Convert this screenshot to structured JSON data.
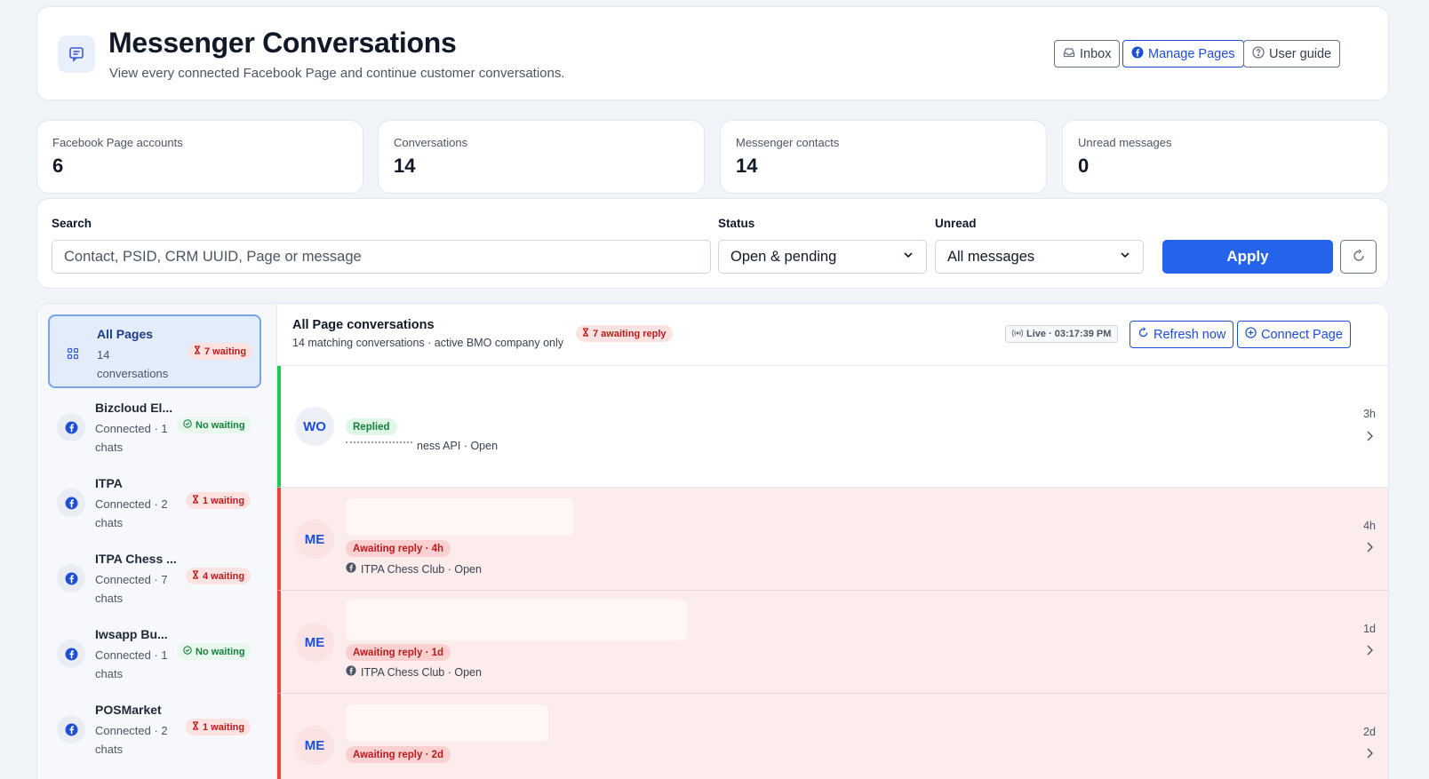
{
  "header": {
    "title": "Messenger Conversations",
    "subtitle": "View every connected Facebook Page and continue customer conversations.",
    "buttons": {
      "inbox": "Inbox",
      "manage_pages": "Manage Pages",
      "user_guide": "User guide"
    }
  },
  "stats": [
    {
      "label": "Facebook Page accounts",
      "value": "6"
    },
    {
      "label": "Conversations",
      "value": "14"
    },
    {
      "label": "Messenger contacts",
      "value": "14"
    },
    {
      "label": "Unread messages",
      "value": "0"
    }
  ],
  "filters": {
    "search_label": "Search",
    "search_placeholder": "Contact, PSID, CRM UUID, Page or message",
    "status_label": "Status",
    "status_value": "Open & pending",
    "unread_label": "Unread",
    "unread_value": "All messages",
    "apply_label": "Apply"
  },
  "sidebar": {
    "items": [
      {
        "name": "All Pages",
        "meta": "14 conversations",
        "badge": "7 waiting",
        "badge_type": "waiting",
        "icon": "grid-icon"
      },
      {
        "name": "Bizcloud El...",
        "meta": "Connected · 1 chats",
        "badge": "No waiting",
        "badge_type": "none",
        "icon": "facebook-icon"
      },
      {
        "name": "ITPA",
        "meta": "Connected · 2 chats",
        "badge": "1 waiting",
        "badge_type": "waiting",
        "icon": "facebook-icon"
      },
      {
        "name": "ITPA Chess ...",
        "meta": "Connected · 7 chats",
        "badge": "4 waiting",
        "badge_type": "waiting",
        "icon": "facebook-icon"
      },
      {
        "name": "Iwsapp Bu...",
        "meta": "Connected · 1 chats",
        "badge": "No waiting",
        "badge_type": "none",
        "icon": "facebook-icon"
      },
      {
        "name": "POSMarket",
        "meta": "Connected · 2 chats",
        "badge": "1 waiting",
        "badge_type": "waiting",
        "icon": "facebook-icon"
      }
    ]
  },
  "list": {
    "title": "All Page conversations",
    "subtitle": "14 matching conversations · active BMO company only",
    "awaiting_badge": "7 awaiting reply",
    "live": "Live · 03:17:39 PM",
    "refresh_label": "Refresh now",
    "connect_label": "Connect Page"
  },
  "conversations": [
    {
      "initials": "WO",
      "status": "Replied",
      "meta": "ness API · Open",
      "time": "3h"
    },
    {
      "initials": "ME",
      "status": "Awaiting reply · 4h",
      "meta": "ITPA Chess Club · Open",
      "time": "4h"
    },
    {
      "initials": "ME",
      "status": "Awaiting reply · 1d",
      "meta": "ITPA Chess Club · Open",
      "time": "1d"
    },
    {
      "initials": "ME",
      "status": "Awaiting reply · 2d",
      "meta": "",
      "time": "2d"
    }
  ],
  "colors": {
    "accent": "#2563eb",
    "waiting": "#b91c1c",
    "ok": "#15803d",
    "awaiting_row": "#fdecec"
  }
}
